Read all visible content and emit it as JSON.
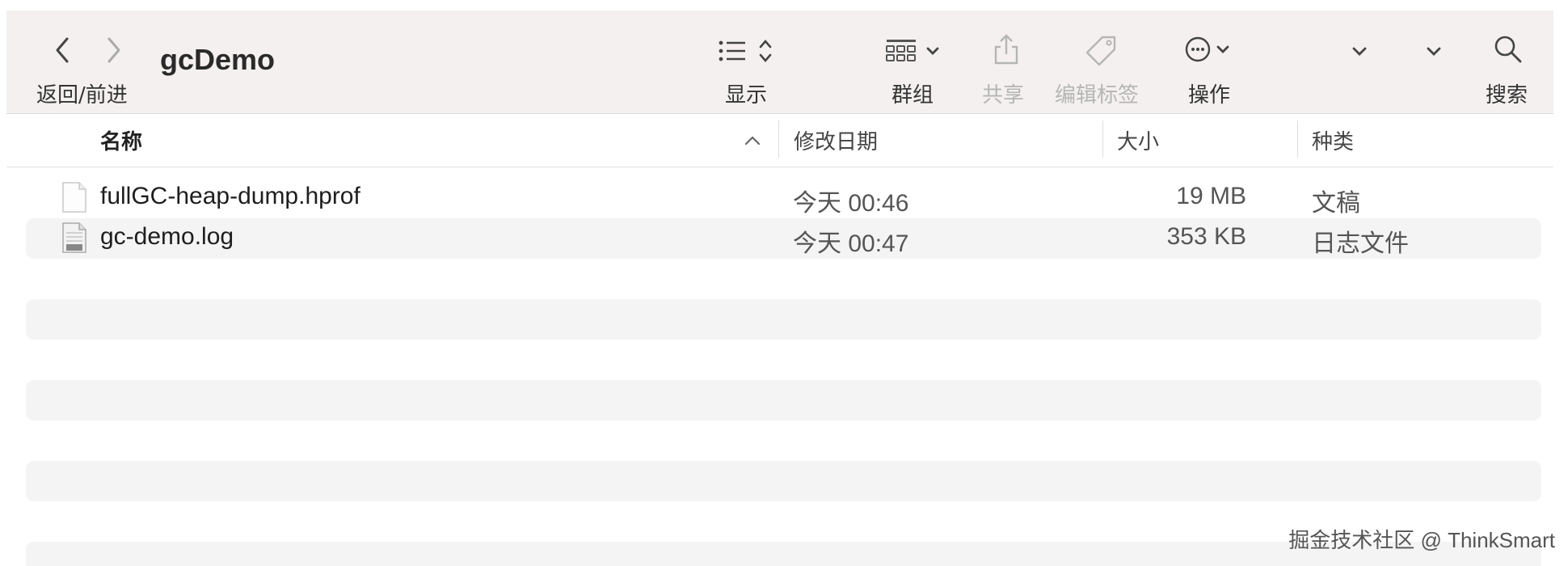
{
  "window": {
    "title": "gcDemo"
  },
  "toolbar": {
    "nav_label": "返回/前进",
    "view_label": "显示",
    "group_label": "群组",
    "share_label": "共享",
    "tags_label": "编辑标签",
    "action_label": "操作",
    "search_label": "搜索"
  },
  "columns": {
    "name": "名称",
    "modified": "修改日期",
    "size": "大小",
    "kind": "种类"
  },
  "files": [
    {
      "name": "fullGC-heap-dump.hprof",
      "modified": "今天 00:46",
      "size": "19 MB",
      "kind": "文稿",
      "icon": "document-icon"
    },
    {
      "name": "gc-demo.log",
      "modified": "今天 00:47",
      "size": "353 KB",
      "kind": "日志文件",
      "icon": "log-file-icon"
    }
  ],
  "watermark": "掘金技术社区 @ ThinkSmart",
  "colors": {
    "toolbar_bg": "#f5f0f0",
    "row_alt": "#f4f4f4",
    "disabled": "#b5b5b5"
  }
}
